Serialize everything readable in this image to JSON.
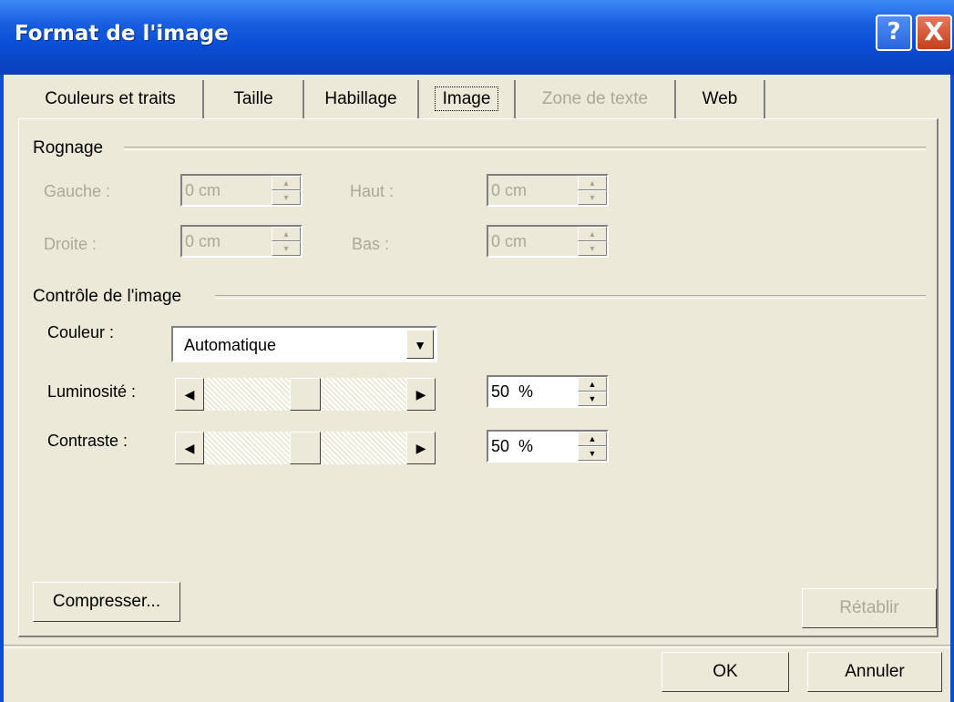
{
  "window": {
    "title": "Format de l'image",
    "help": "?",
    "close": "X"
  },
  "tabs": [
    {
      "label": "Couleurs et traits"
    },
    {
      "label": "Taille"
    },
    {
      "label": "Habillage"
    },
    {
      "label": "Image"
    },
    {
      "label": "Zone de texte"
    },
    {
      "label": "Web"
    }
  ],
  "rognage": {
    "title": "Rognage",
    "gauche": {
      "label": "Gauche :",
      "value": "0 cm"
    },
    "haut": {
      "label": "Haut :",
      "value": "0 cm"
    },
    "droite": {
      "label": "Droite :",
      "value": "0 cm"
    },
    "bas": {
      "label": "Bas :",
      "value": "0 cm"
    }
  },
  "controle": {
    "title": "Contrôle de l'image",
    "couleur": {
      "label": "Couleur :",
      "value": "Automatique"
    },
    "luminosite": {
      "label": "Luminosité :",
      "value": "50  %",
      "level": 50
    },
    "contraste": {
      "label": "Contraste :",
      "value": "50  %",
      "level": 50
    }
  },
  "buttons": {
    "compresser": "Compresser...",
    "retablir": "Rétablir",
    "ok": "OK",
    "annuler": "Annuler"
  }
}
